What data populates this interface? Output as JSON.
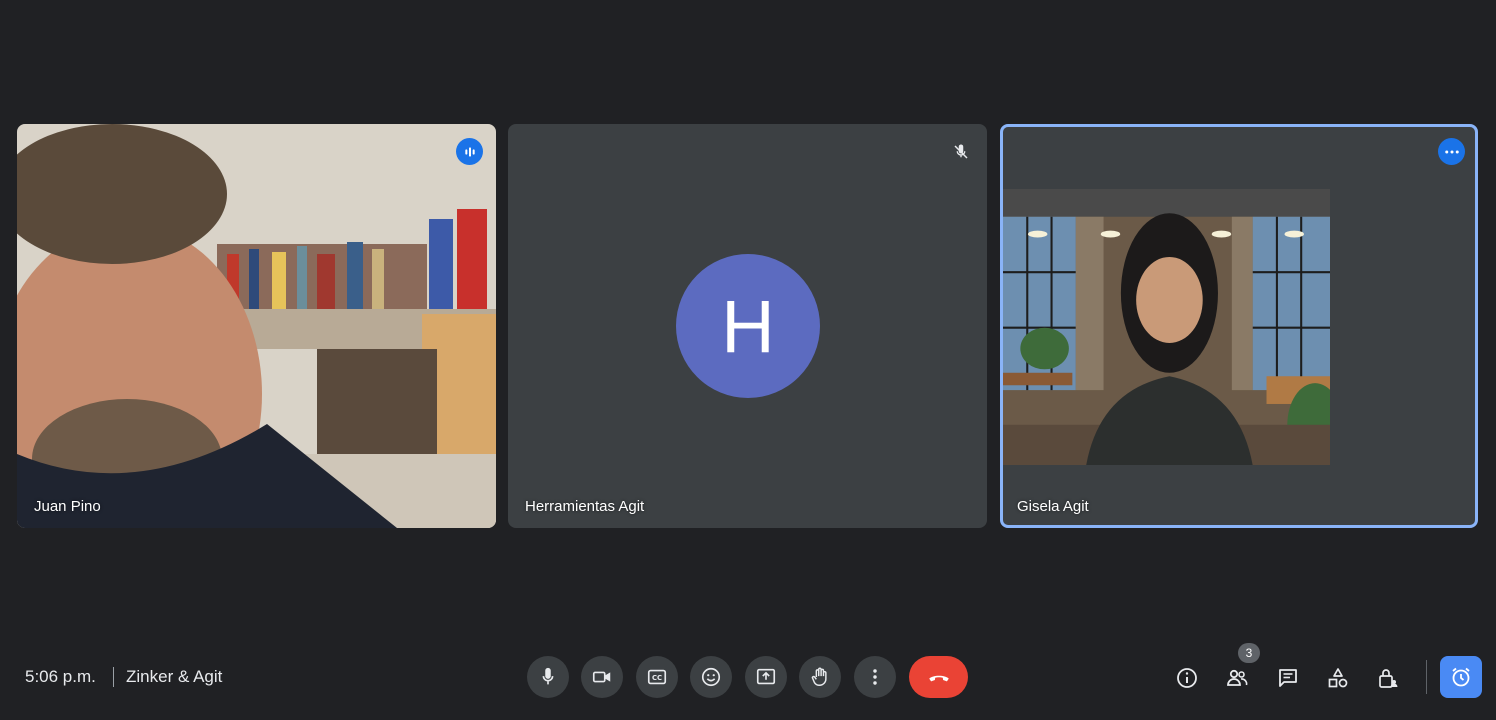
{
  "participants": [
    {
      "name": "Juan Pino",
      "status_icon": "speaking-indicator-icon"
    },
    {
      "name": "Herramientas Agit",
      "avatar_letter": "H",
      "status_icon": "mic-off-icon"
    },
    {
      "name": "Gisela Agit",
      "status_icon": "more-options-icon"
    }
  ],
  "footer": {
    "time": "5:06 p.m.",
    "meeting_name": "Zinker & Agit",
    "people_count": "3"
  },
  "colors": {
    "background": "#202124",
    "tile": "#3c4043",
    "accent": "#1a73e8",
    "end_call": "#ea4335",
    "avatar": "#5c6bc0",
    "active_border": "#8ab4f8"
  }
}
